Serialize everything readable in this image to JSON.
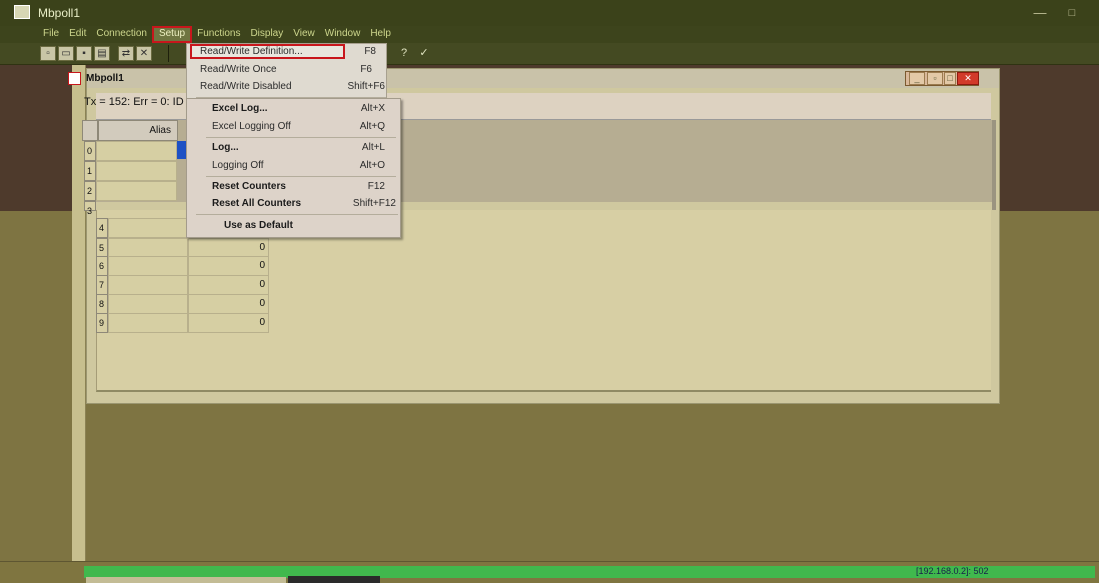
{
  "window": {
    "title": "Mbpoll1",
    "minimize_glyph": "—",
    "maximize_glyph": "□"
  },
  "menubar": {
    "items": [
      "File",
      "Edit",
      "Connection",
      "Setup",
      "Functions",
      "Display",
      "View",
      "Window",
      "Help"
    ],
    "active": "Setup"
  },
  "toolbar": {
    "right_buttons": [
      "f?",
      "?",
      "✓"
    ]
  },
  "child_window": {
    "title": "Mbpoll1",
    "status_text": "Tx = 152: Err = 0: ID ="
  },
  "grid": {
    "header_alias": "Alias",
    "rows": [
      {
        "num": "0",
        "value": ""
      },
      {
        "num": "1",
        "value": ""
      },
      {
        "num": "2",
        "value": ""
      },
      {
        "num": "3",
        "value": ""
      },
      {
        "num": "4",
        "value": "0"
      },
      {
        "num": "5",
        "value": "0"
      },
      {
        "num": "6",
        "value": "0"
      },
      {
        "num": "7",
        "value": "0"
      },
      {
        "num": "8",
        "value": "0"
      },
      {
        "num": "9",
        "value": "0"
      }
    ]
  },
  "setup_menu": {
    "items": [
      {
        "label": "Read/Write Definition...",
        "shortcut": "F8"
      },
      {
        "label": "Read/Write Once",
        "shortcut": "F6"
      },
      {
        "label": "Read/Write Disabled",
        "shortcut": "Shift+F6"
      },
      {
        "label": "Excel Log...",
        "shortcut": "Alt+X"
      },
      {
        "label": "Excel Logging Off",
        "shortcut": "Alt+Q"
      },
      {
        "label": "Log...",
        "shortcut": "Alt+L"
      },
      {
        "label": "Logging Off",
        "shortcut": "Alt+O"
      },
      {
        "label": "Reset Counters",
        "shortcut": "F12"
      },
      {
        "label": "Reset All Counters",
        "shortcut": "Shift+F12"
      },
      {
        "label": "Use as Default",
        "shortcut": ""
      }
    ]
  },
  "status_bar": {
    "connection": "[192.168.0.2]: 502"
  },
  "colors": {
    "accent_red": "#c8161c",
    "selection_blue": "#1d51c4",
    "status_green": "#40b84d"
  }
}
